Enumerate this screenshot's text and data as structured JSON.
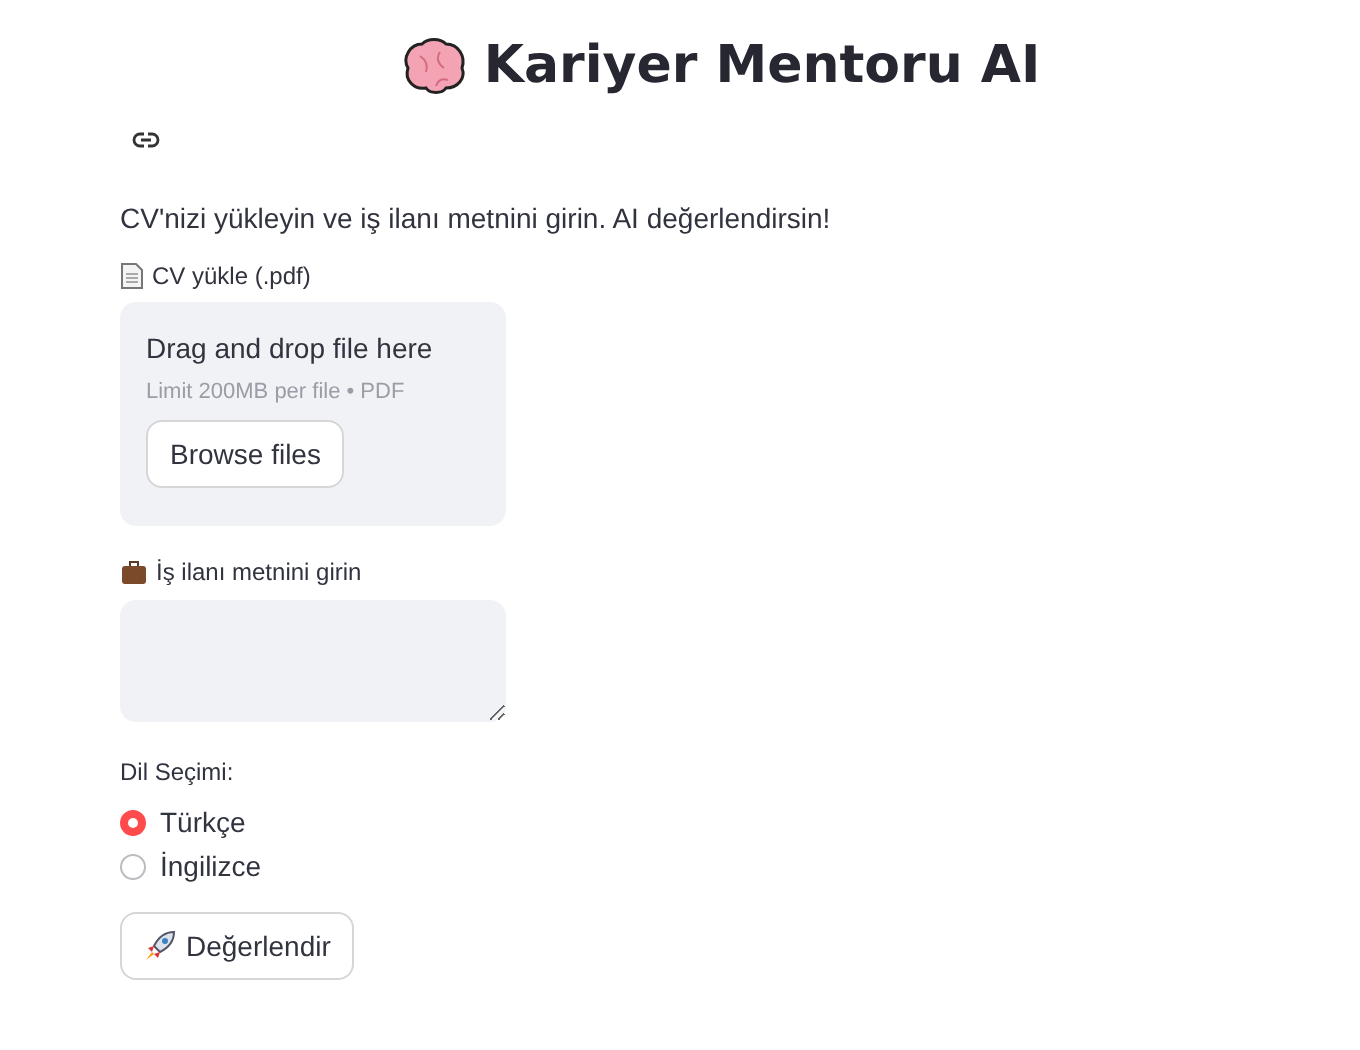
{
  "title": "Kariyer Mentoru AI",
  "intro": "CV'nizi yükleyin ve iş ilanı metnini girin. AI değerlendirsin!",
  "uploader": {
    "label": "CV yükle (.pdf)",
    "instruction": "Drag and drop file here",
    "limits": "Limit 200MB per file • PDF",
    "button": "Browse files"
  },
  "job_text": {
    "label": "İş ilanı metnini girin"
  },
  "language": {
    "label": "Dil Seçimi:",
    "options": [
      {
        "label": "Türkçe",
        "selected": true
      },
      {
        "label": "İngilizce",
        "selected": false
      }
    ]
  },
  "submit": "Değerlendir"
}
